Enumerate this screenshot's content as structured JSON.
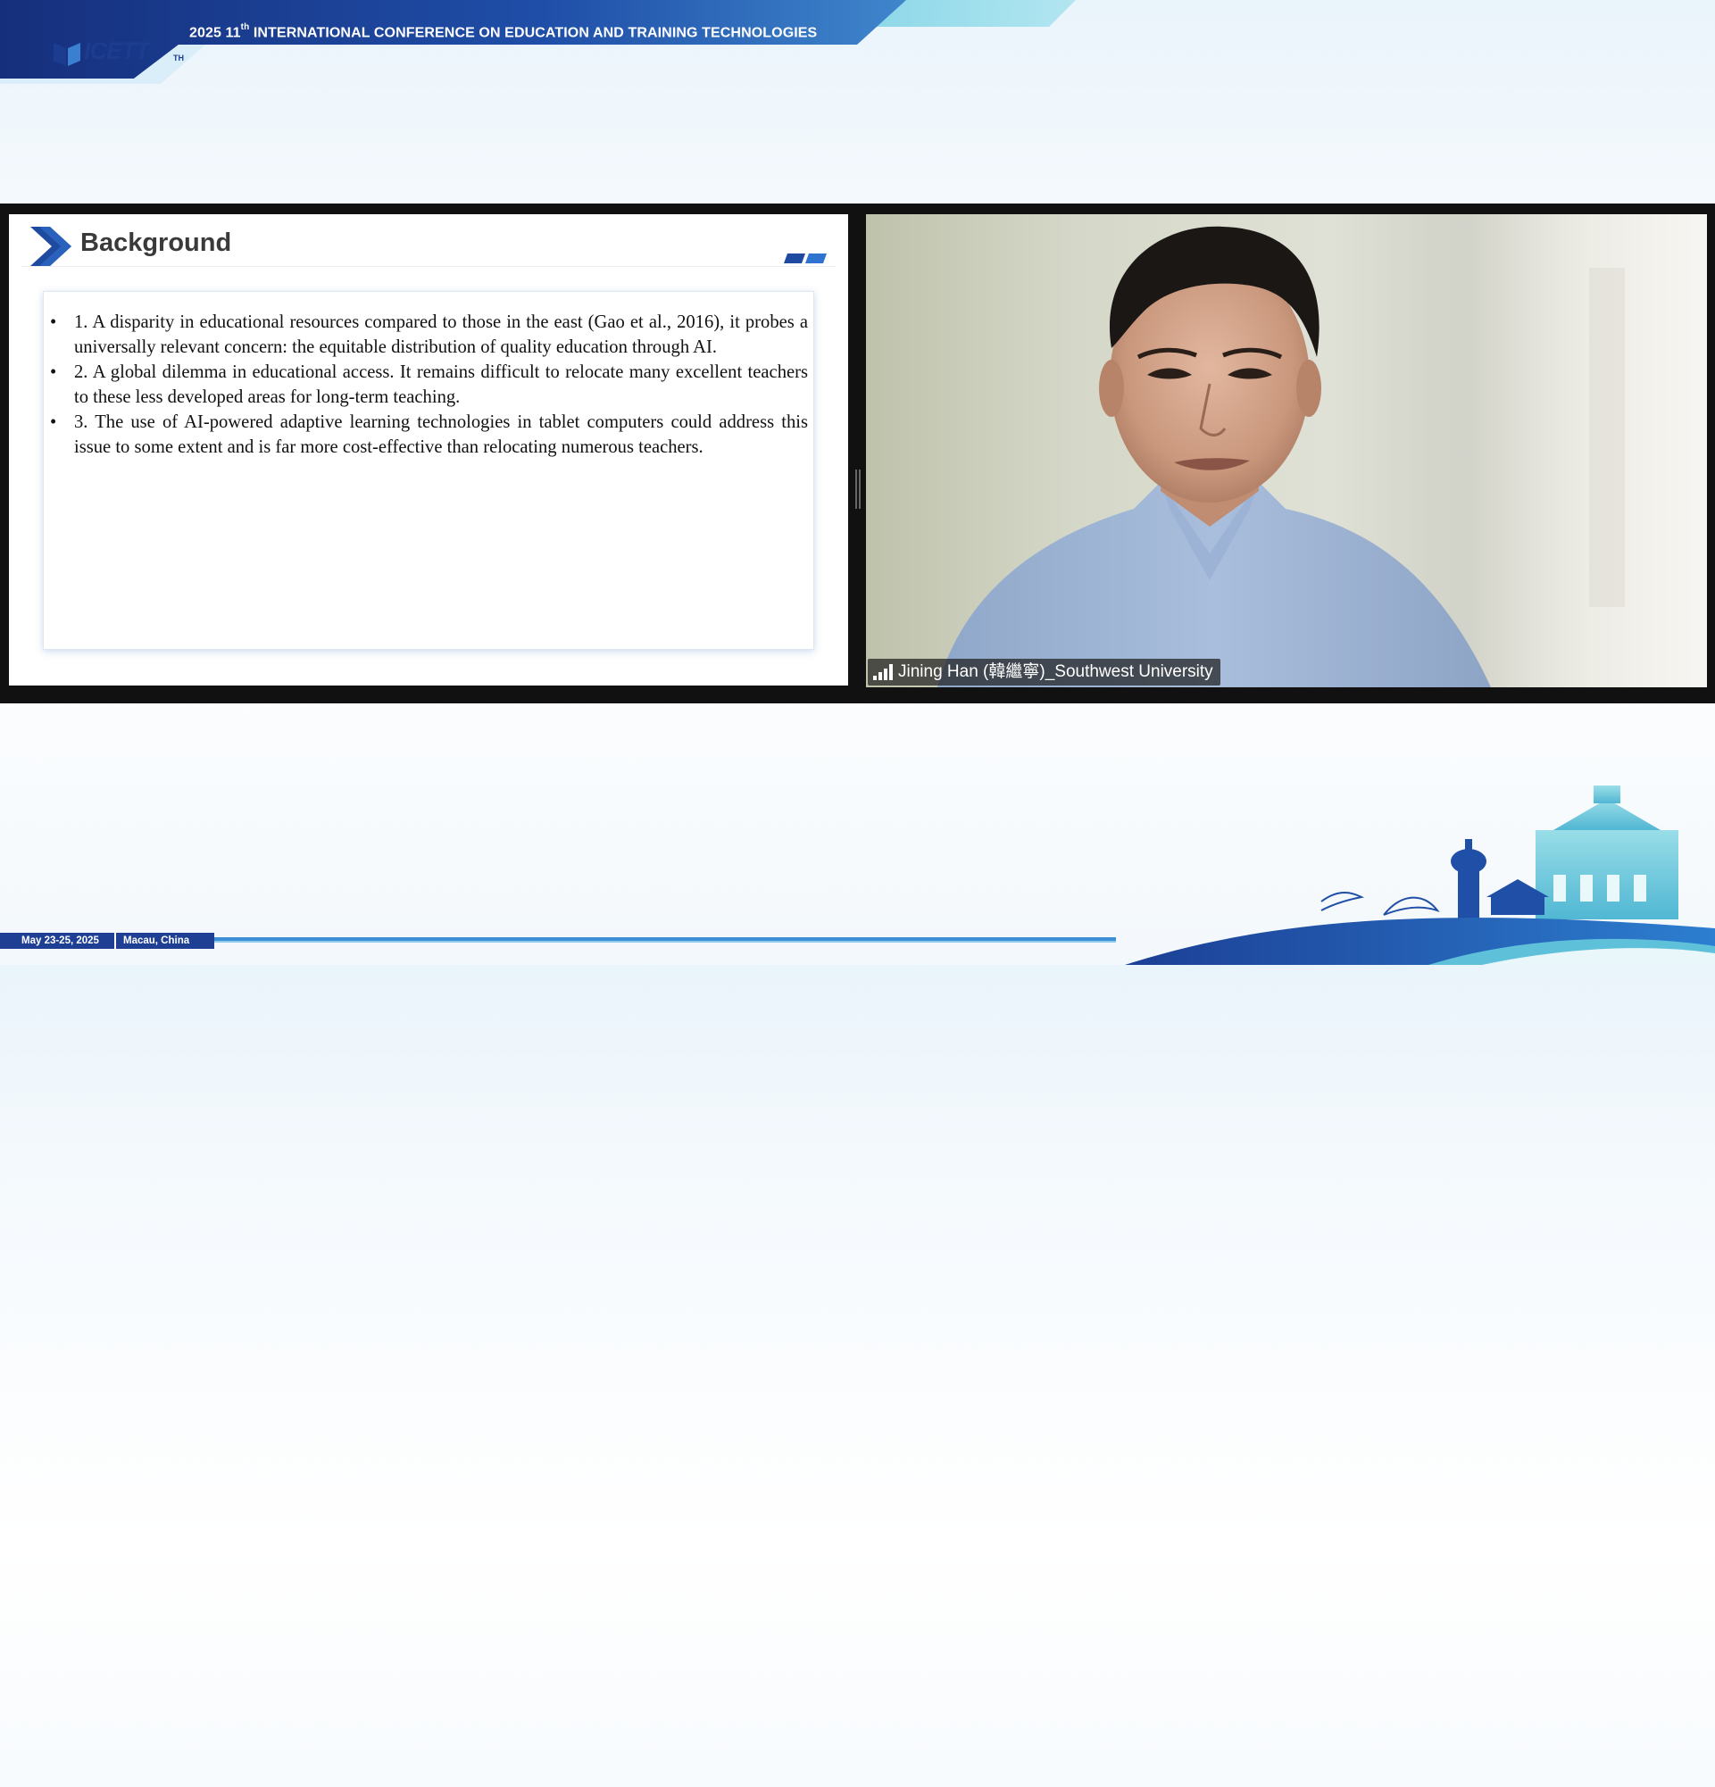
{
  "header": {
    "conference_year": "2025 11",
    "ordinal_suffix": "th",
    "conference_title": "INTERNATIONAL CONFERENCE ON EDUCATION AND TRAINING TECHNOLOGIES",
    "logo_text": "ICETT",
    "logo_suffix": "TH"
  },
  "slide": {
    "title": "Background",
    "bullets": [
      "1. A disparity in educational resources compared to those in the east (Gao et al., 2016), it probes a universally relevant concern: the equitable distribution of quality education through AI.",
      "2. A global dilemma in educational access. It remains difficult to relocate many excellent teachers to these less developed areas for long-term teaching.",
      "3. The use of AI-powered adaptive learning technologies in tablet computers could address this issue to some extent and is far more cost-effective than relocating numerous teachers."
    ]
  },
  "video": {
    "participant_name": "Jining Han (韓繼寧)_Southwest University",
    "signal_icon": "signal-strength-icon"
  },
  "footer": {
    "date": "May 23-25, 2025",
    "location": "Macau, China"
  },
  "colors": {
    "brand_blue": "#1e3f94",
    "accent_cyan": "#5fc1d9"
  }
}
